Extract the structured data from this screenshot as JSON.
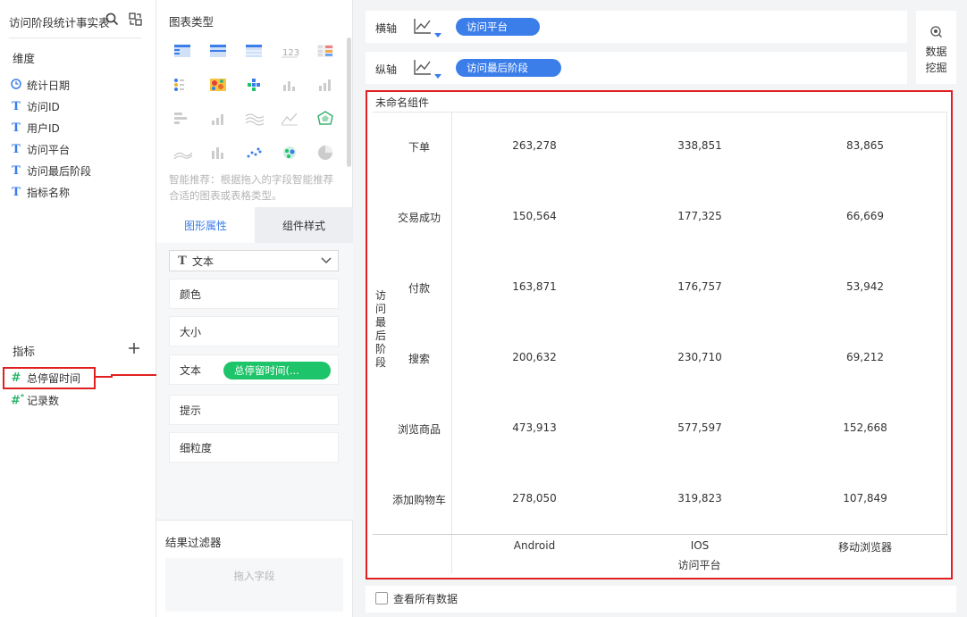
{
  "left": {
    "dataset_title": "访问阶段统计事实表",
    "dimensions_label": "维度",
    "dimensions": [
      {
        "label": "统计日期",
        "type": "date"
      },
      {
        "label": "访问ID",
        "type": "text"
      },
      {
        "label": "用户ID",
        "type": "text"
      },
      {
        "label": "访问平台",
        "type": "text"
      },
      {
        "label": "访问最后阶段",
        "type": "text"
      },
      {
        "label": "指标名称",
        "type": "text"
      }
    ],
    "metrics_label": "指标",
    "add_icon": "plus-icon",
    "metrics": [
      {
        "label": "总停留时间",
        "icon": "#"
      },
      {
        "label": "记录数",
        "icon": "#*"
      }
    ]
  },
  "middle": {
    "chart_type_label": "图表类型",
    "smart_tip": "智能推荐：根据拖入的字段智能推荐合适的图表或表格类型。",
    "tabs": [
      "图形属性",
      "组件样式"
    ],
    "mark_select": "文本",
    "properties": [
      "颜色",
      "大小",
      "文本",
      "提示",
      "细粒度"
    ],
    "text_pill": "总停留时间(...",
    "filter_label": "结果过滤器",
    "filter_placeholder": "拖入字段"
  },
  "axes": {
    "x_label": "横轴",
    "x_field": "访问平台",
    "y_label": "纵轴",
    "y_field": "访问最后阶段",
    "mining_label_1": "数据",
    "mining_label_2": "挖掘"
  },
  "table": {
    "title": "未命名组件",
    "row_header": "访问最后阶段",
    "col_header": "访问平台",
    "columns": [
      "Android",
      "IOS",
      "移动浏览器"
    ],
    "rows": [
      {
        "label": "下单",
        "values": [
          "263,278",
          "338,851",
          "83,865"
        ]
      },
      {
        "label": "交易成功",
        "values": [
          "150,564",
          "177,325",
          "66,669"
        ]
      },
      {
        "label": "付款",
        "values": [
          "163,871",
          "176,757",
          "53,942"
        ]
      },
      {
        "label": "搜索",
        "values": [
          "200,632",
          "230,710",
          "69,212"
        ]
      },
      {
        "label": "浏览商品",
        "values": [
          "473,913",
          "577,597",
          "152,668"
        ]
      },
      {
        "label": "添加购物车",
        "values": [
          "278,050",
          "319,823",
          "107,849"
        ]
      }
    ]
  },
  "footer": {
    "view_all_label": "查看所有数据"
  },
  "colors": {
    "accent_blue": "#3b7de9",
    "pill_green": "#1ec469",
    "highlight_red": "#e02020"
  }
}
